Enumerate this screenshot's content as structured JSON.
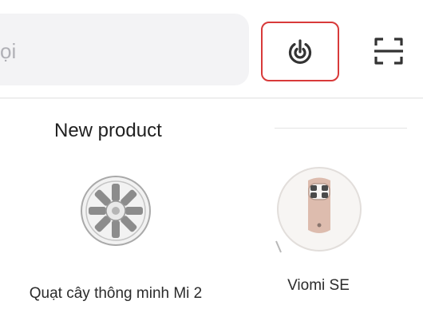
{
  "search": {
    "placeholder_fragment": "ọi"
  },
  "header": {
    "power_icon": "power-icon",
    "scan_icon": "scan-icon",
    "highlight_color": "#d83a3a"
  },
  "section": {
    "title": "New product"
  },
  "products": [
    {
      "name": "Quạt cây thông minh Mi 2",
      "icon": "fan-image"
    },
    {
      "name": "Viomi SE",
      "icon": "robot-vacuum-image"
    }
  ]
}
